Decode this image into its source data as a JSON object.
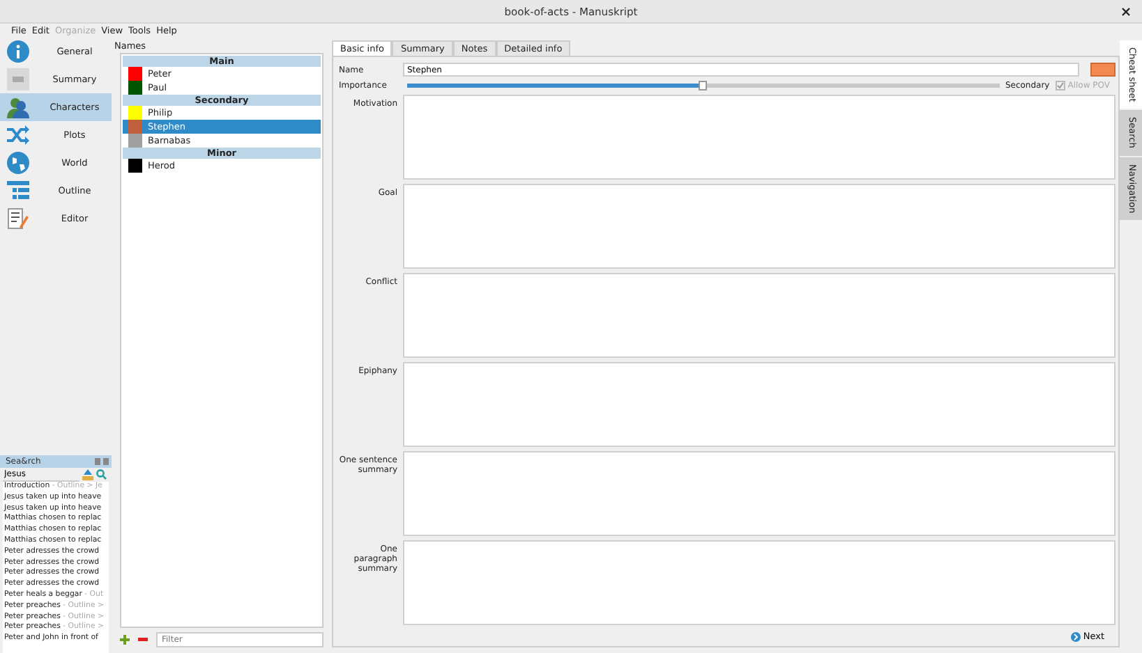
{
  "window": {
    "title": "book-of-acts - Manuskript"
  },
  "menu": [
    {
      "label": "File",
      "disabled": false
    },
    {
      "label": "Edit",
      "disabled": false
    },
    {
      "label": "Organize",
      "disabled": true
    },
    {
      "label": "View",
      "disabled": false
    },
    {
      "label": "Tools",
      "disabled": false
    },
    {
      "label": "Help",
      "disabled": false
    }
  ],
  "nav": [
    {
      "label": "General",
      "kind": "info",
      "selected": false
    },
    {
      "label": "Summary",
      "kind": "summary",
      "selected": false
    },
    {
      "label": "Characters",
      "kind": "characters",
      "selected": true
    },
    {
      "label": "Plots",
      "kind": "plots",
      "selected": false
    },
    {
      "label": "World",
      "kind": "world",
      "selected": false
    },
    {
      "label": "Outline",
      "kind": "outline",
      "selected": false
    },
    {
      "label": "Editor",
      "kind": "editor",
      "selected": false
    }
  ],
  "search_dock": {
    "title": "Sea&rch",
    "query": "Jesus",
    "results": [
      {
        "title": "Introduction",
        "path": "- Outline > Je"
      },
      {
        "title": "Jesus taken up into heave"
      },
      {
        "title": "Jesus taken up into heave"
      },
      {
        "title": "Matthias chosen to replac"
      },
      {
        "title": "Matthias chosen to replac"
      },
      {
        "title": "Matthias chosen to replac"
      },
      {
        "title": "Peter adresses the crowd"
      },
      {
        "title": "Peter adresses the crowd"
      },
      {
        "title": "Peter adresses the crowd"
      },
      {
        "title": "Peter adresses the crowd"
      },
      {
        "title": "Peter heals a beggar",
        "path": "- Out"
      },
      {
        "title": "Peter preaches",
        "path": "- Outline >"
      },
      {
        "title": "Peter preaches",
        "path": "- Outline >"
      },
      {
        "title": "Peter preaches",
        "path": "- Outline >"
      },
      {
        "title": "Peter and John in front of"
      }
    ]
  },
  "names": {
    "label": "Names",
    "filter_placeholder": "Filter",
    "groups": [
      {
        "title": "Main",
        "characters": [
          {
            "name": "Peter",
            "color": "#ff0000",
            "selected": false
          },
          {
            "name": "Paul",
            "color": "#005500",
            "selected": false
          }
        ]
      },
      {
        "title": "Secondary",
        "characters": [
          {
            "name": "Philip",
            "color": "#ffff00",
            "selected": false
          },
          {
            "name": "Stephen",
            "color": "#c0603a",
            "selected": true
          },
          {
            "name": "Barnabas",
            "color": "#a0a0a0",
            "selected": false
          }
        ]
      },
      {
        "title": "Minor",
        "characters": [
          {
            "name": "Herod",
            "color": "#000000",
            "selected": false
          }
        ]
      }
    ]
  },
  "tabs": [
    {
      "label": "Basic info",
      "selected": true
    },
    {
      "label": "Summary",
      "selected": false
    },
    {
      "label": "Notes",
      "selected": false
    },
    {
      "label": "Detailed info",
      "selected": false
    }
  ],
  "basic_info": {
    "name_label": "Name",
    "name_value": "Stephen",
    "color": "#f28a52",
    "importance_label": "Importance",
    "importance": {
      "level": 0.5,
      "reading": "Secondary"
    },
    "allow_pov": {
      "label": "Allow POV",
      "checked": true,
      "disabled": true
    },
    "fields": [
      "Motivation",
      "Goal",
      "Conflict",
      "Epiphany",
      "One sentence summary",
      "One paragraph summary"
    ],
    "next": "Next"
  },
  "side_tabs": [
    {
      "label": "Cheat sheet",
      "selected": true
    },
    {
      "label": "Search",
      "selected": false
    },
    {
      "label": "Navigation",
      "selected": false
    }
  ]
}
